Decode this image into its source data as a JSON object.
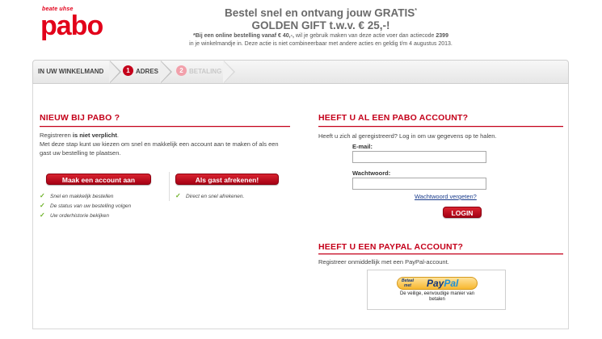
{
  "logo": {
    "tagline": "beate uhse",
    "brand": "pabo"
  },
  "promo": {
    "line1": "Bestel snel en ontvang jouw GRATIS",
    "line1_sup": "*",
    "line2": "GOLDEN GIFT t.w.v. € 25,-!",
    "line3a_pre": "*Bij een online bestelling vanaf € 40,-,",
    "line3a_post": " wil je gebruik maken van deze actie voer dan actiecode ",
    "code": "2399",
    "line3b": "in je winkelmandje in. Deze actie is niet combineerbaar met andere acties en geldig t/m 4 augustus 2013."
  },
  "steps": [
    {
      "label": "IN UW WINKELMAND"
    },
    {
      "num": "1",
      "label": "ADRES"
    },
    {
      "num": "2",
      "label": "BETALING"
    }
  ],
  "new": {
    "title": "NIEUW BIJ PABO ?",
    "text1_pre": "Registreren ",
    "text1_bold": "is niet verplicht",
    "text1_post": ".",
    "text2": "Met deze stap kunt uw kiezen om snel en makkelijk een account aan te maken of als een gast uw bestelling te plaatsen.",
    "create_button": "Maak een account aan",
    "guest_button": "Als gast afrekenen!",
    "create_benefits": [
      "Snel en makkelijk bestellen",
      "De status van uw bestelling volgen",
      "Uw orderhistorie bekijken"
    ],
    "guest_benefits": [
      "Direct en snel afrekenen."
    ]
  },
  "account": {
    "title": "HEEFT U AL EEN PABO ACCOUNT?",
    "text": "Heeft u zich al geregistreerd? Log in om uw gegevens op te halen.",
    "email_label": "E-mail:",
    "email_value": "",
    "password_label": "Wachtwoord:",
    "password_value": "",
    "forgot": "Wachtwoord vergeten?",
    "login_button": "LOGIN"
  },
  "paypal": {
    "title": "HEEFT U EEN PAYPAL ACCOUNT?",
    "text": "Registreer onmiddellijk met een PayPal-account.",
    "btn_small1": "Betaal",
    "btn_small2": "met",
    "btn_word1": "Pay",
    "btn_word2": "Pal",
    "caption": "De veilige, eenvoudige manier van betalen"
  },
  "colors": {
    "brand_red": "#c4001a",
    "check_green": "#6ab023",
    "link_blue": "#1a3c8c"
  }
}
